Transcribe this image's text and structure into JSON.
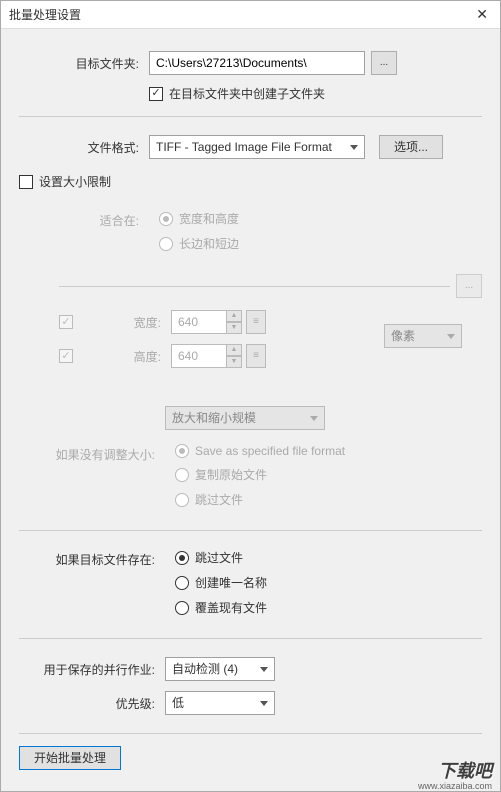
{
  "title": "批量处理设置",
  "target_folder_label": "目标文件夹:",
  "target_folder_value": "C:\\Users\\27213\\Documents\\",
  "browse_ellipsis": "...",
  "create_subfolder_label": "在目标文件夹中创建子文件夹",
  "file_format_label": "文件格式:",
  "file_format_value": "TIFF - Tagged Image File Format",
  "options_btn": "选项...",
  "set_size_limit_label": "设置大小限制",
  "fit_label": "适合在:",
  "fit_opt1": "宽度和高度",
  "fit_opt2": "长边和短边",
  "width_label": "宽度:",
  "height_label": "高度:",
  "width_value": "640",
  "height_value": "640",
  "unit_label": "像素",
  "scale_mode": "放大和缩小规模",
  "no_resize_label": "如果没有调整大小:",
  "no_resize_opt1": "Save as specified file format",
  "no_resize_opt2": "复制原始文件",
  "no_resize_opt3": "跳过文件",
  "target_exists_label": "如果目标文件存在:",
  "target_exists_opt1": "跳过文件",
  "target_exists_opt2": "创建唯一名称",
  "target_exists_opt3": "覆盖现有文件",
  "parallel_jobs_label": "用于保存的并行作业:",
  "parallel_jobs_value": "自动检测  (4)",
  "priority_label": "优先级:",
  "priority_value": "低",
  "start_btn": "开始批量处理",
  "watermark": "下载吧",
  "watermark_sub": "www.xiazaiba.com"
}
